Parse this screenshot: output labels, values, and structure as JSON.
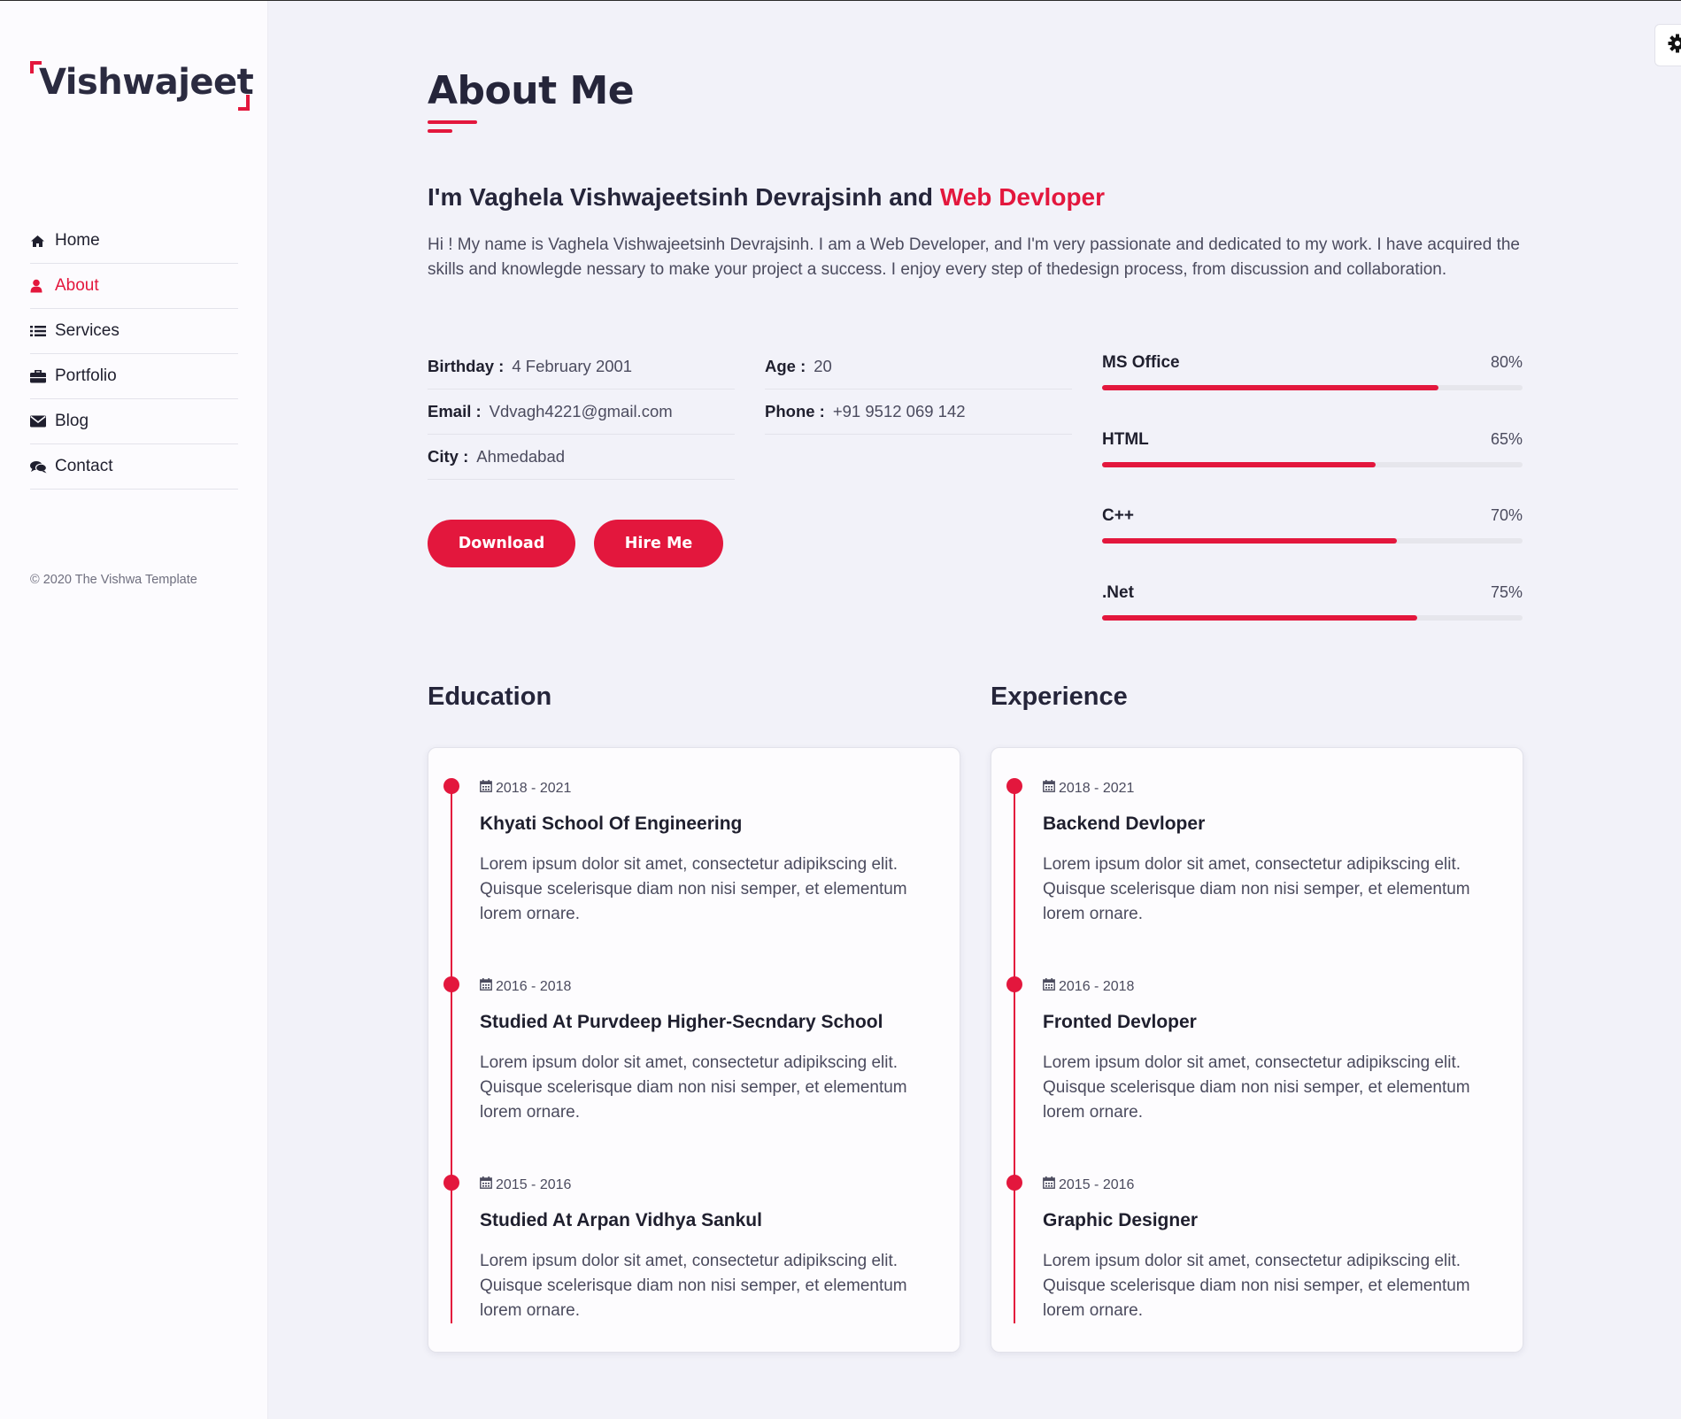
{
  "sidebar": {
    "logo": "Vishwajeet",
    "nav": [
      {
        "label": "Home",
        "icon": "home-icon"
      },
      {
        "label": "About",
        "icon": "user-icon",
        "active": true
      },
      {
        "label": "Services",
        "icon": "list-icon"
      },
      {
        "label": "Portfolio",
        "icon": "briefcase-icon"
      },
      {
        "label": "Blog",
        "icon": "envelope-icon"
      },
      {
        "label": "Contact",
        "icon": "comments-icon"
      }
    ],
    "copyright": "© 2020 The Vishwa Template"
  },
  "main": {
    "title": "About Me",
    "intro_heading_prefix": "I'm Vaghela Vishwajeetsinh Devrajsinh and ",
    "intro_heading_accent": "Web Devloper",
    "intro_text": "Hi ! My name is Vaghela Vishwajeetsinh Devrajsinh. I am a Web Developer, and I'm very passionate and dedicated to my work. I have acquired the skills and knowlegde nessary to make your project a success. I enjoy every step of thedesign process, from discussion and collaboration.",
    "info": {
      "birthday": {
        "label": "Birthday :",
        "value": "4 February 2001"
      },
      "email": {
        "label": "Email :",
        "value": "Vdvagh4221@gmail.com"
      },
      "city": {
        "label": "City :",
        "value": "Ahmedabad"
      },
      "age": {
        "label": "Age :",
        "value": "20"
      },
      "phone": {
        "label": "Phone :",
        "value": "+91 9512 069 142"
      }
    },
    "buttons": {
      "download": "Download",
      "hire": "Hire Me"
    },
    "skills": [
      {
        "name": "MS Office",
        "percent": "80%",
        "value": 80
      },
      {
        "name": "HTML",
        "percent": "65%",
        "value": 65
      },
      {
        "name": "C++",
        "percent": "70%",
        "value": 70
      },
      {
        "name": ".Net",
        "percent": "75%",
        "value": 75
      }
    ],
    "education": {
      "title": "Education",
      "items": [
        {
          "date": "2018 - 2021",
          "title": "Khyati School Of Engineering",
          "desc": "Lorem ipsum dolor sit amet, consectetur adipikscing elit. Quisque scelerisque diam non nisi semper, et elementum lorem ornare."
        },
        {
          "date": "2016 - 2018",
          "title": "Studied At Purvdeep Higher-Secndary School",
          "desc": "Lorem ipsum dolor sit amet, consectetur adipikscing elit. Quisque scelerisque diam non nisi semper, et elementum lorem ornare."
        },
        {
          "date": "2015 - 2016",
          "title": "Studied At Arpan Vidhya Sankul",
          "desc": "Lorem ipsum dolor sit amet, consectetur adipikscing elit. Quisque scelerisque diam non nisi semper, et elementum lorem ornare."
        }
      ]
    },
    "experience": {
      "title": "Experience",
      "items": [
        {
          "date": "2018 - 2021",
          "title": "Backend Devloper",
          "desc": "Lorem ipsum dolor sit amet, consectetur adipikscing elit. Quisque scelerisque diam non nisi semper, et elementum lorem ornare."
        },
        {
          "date": "2016 - 2018",
          "title": "Fronted Devloper",
          "desc": "Lorem ipsum dolor sit amet, consectetur adipikscing elit. Quisque scelerisque diam non nisi semper, et elementum lorem ornare."
        },
        {
          "date": "2015 - 2016",
          "title": "Graphic Designer",
          "desc": "Lorem ipsum dolor sit amet, consectetur adipikscing elit. Quisque scelerisque diam non nisi semper, et elementum lorem ornare."
        }
      ]
    }
  },
  "colors": {
    "accent": "#e3173d",
    "text": "#25253a",
    "background": "#f2f2f9"
  }
}
